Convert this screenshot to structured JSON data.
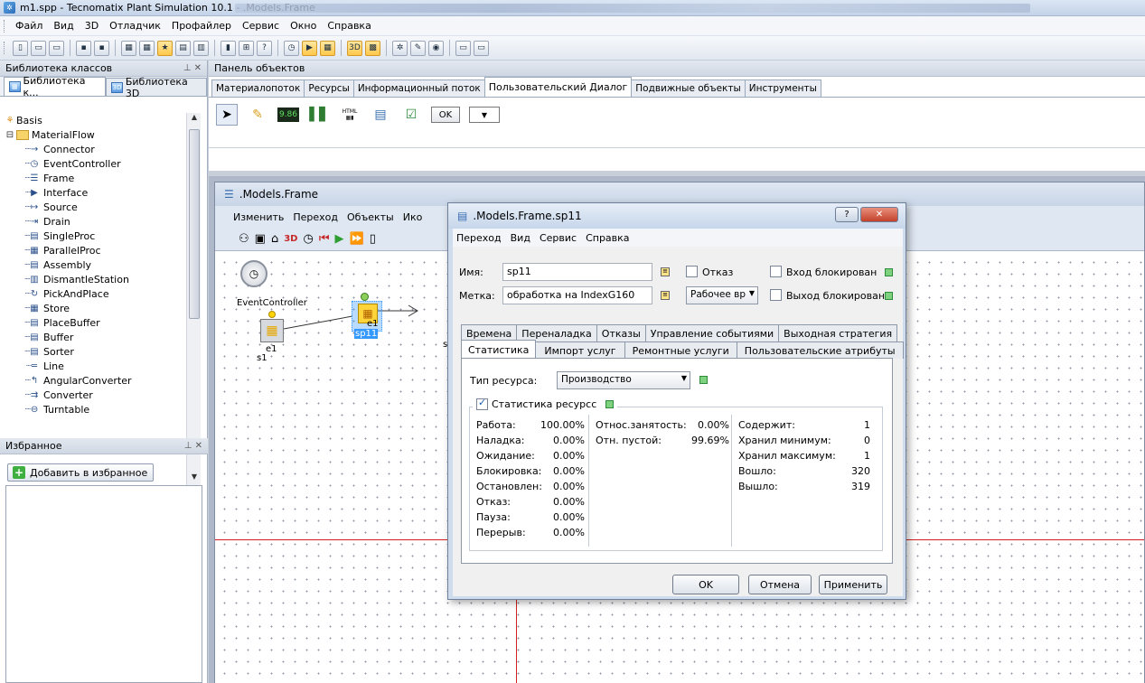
{
  "app": {
    "title": "m1.spp - Tecnomatix Plant Simulation 10.1 - .Models.Frame",
    "menu": [
      "Файл",
      "Вид",
      "3D",
      "Отладчик",
      "Профайлер",
      "Сервис",
      "Окно",
      "Справка"
    ]
  },
  "class_library": {
    "panel_title": "Библиотека классов",
    "tab1": "Библиотека к...",
    "tab2": "Библиотека 3D",
    "root": "Basis",
    "folder": "MaterialFlow",
    "items": [
      "Connector",
      "EventController",
      "Frame",
      "Interface",
      "Source",
      "Drain",
      "SingleProc",
      "ParallelProc",
      "Assembly",
      "DismantleStation",
      "PickAndPlace",
      "Store",
      "PlaceBuffer",
      "Buffer",
      "Sorter",
      "Line",
      "AngularConverter",
      "Converter",
      "Turntable"
    ]
  },
  "favorites": {
    "panel_title": "Избранное",
    "add_button": "Добавить в избранное"
  },
  "object_panel": {
    "title": "Панель объектов",
    "tabs": [
      "Материалопоток",
      "Ресурсы",
      "Информационный поток",
      "Пользовательский Диалог",
      "Подвижные объекты",
      "Инструменты"
    ],
    "active_tab": 3,
    "ok_label": "OK",
    "digits_label": "9.86",
    "html_label": "HTML"
  },
  "frame_window": {
    "title": ".Models.Frame",
    "menu": [
      "Изменить",
      "Переход",
      "Объекты",
      "Ико"
    ],
    "labels": {
      "event_controller": "EventController",
      "s1": "s1",
      "e1_src": "e1",
      "e1_proc": "e1",
      "sp11": "sp11",
      "trail": "s"
    }
  },
  "dialog": {
    "title": ".Models.Frame.sp11",
    "menu": [
      "Переход",
      "Вид",
      "Сервис",
      "Справка"
    ],
    "name_label": "Имя:",
    "name_value": "sp11",
    "label_label": "Метка:",
    "label_value": "обработка на IndexG160",
    "failed_label": "Отказ",
    "work_time_select": "Рабочее вр",
    "entry_blocked": "Вход блокирован",
    "exit_blocked": "Выход блокирован",
    "tabs_row1": [
      "Времена",
      "Переналадка",
      "Отказы",
      "Управление событиями",
      "Выходная стратегия"
    ],
    "tabs_row2": [
      "Статистика",
      "Импорт услуг",
      "Ремонтные услуги",
      "Пользовательские атрибуты"
    ],
    "resource_type_label": "Тип ресурса:",
    "resource_type_value": "Производство",
    "resource_stats_label": "Статистика ресурсс",
    "stats_left": [
      {
        "label": "Работа:",
        "value": "100.00%"
      },
      {
        "label": "Наладка:",
        "value": "0.00%"
      },
      {
        "label": "Ожидание:",
        "value": "0.00%"
      },
      {
        "label": "Блокировка:",
        "value": "0.00%"
      },
      {
        "label": "Остановлен:",
        "value": "0.00%"
      },
      {
        "label": "Отказ:",
        "value": "0.00%"
      },
      {
        "label": "Пауза:",
        "value": "0.00%"
      },
      {
        "label": "Перерыв:",
        "value": "0.00%"
      }
    ],
    "stats_mid": [
      {
        "label": "Относ.занятость:",
        "value": "0.00%"
      },
      {
        "label": "Отн. пустой:",
        "value": "99.69%"
      }
    ],
    "stats_right": [
      {
        "label": "Содержит:",
        "value": "1"
      },
      {
        "label": "Хранил минимум:",
        "value": "0"
      },
      {
        "label": "Хранил максимум:",
        "value": "1"
      },
      {
        "label": "Вошло:",
        "value": "320"
      },
      {
        "label": "Вышло:",
        "value": "319"
      }
    ],
    "ok": "OK",
    "cancel": "Отмена",
    "apply": "Применить"
  },
  "colors": {
    "status_green": "#7ed27f",
    "connector_red": "#d32020",
    "selection": "#3399ff"
  }
}
